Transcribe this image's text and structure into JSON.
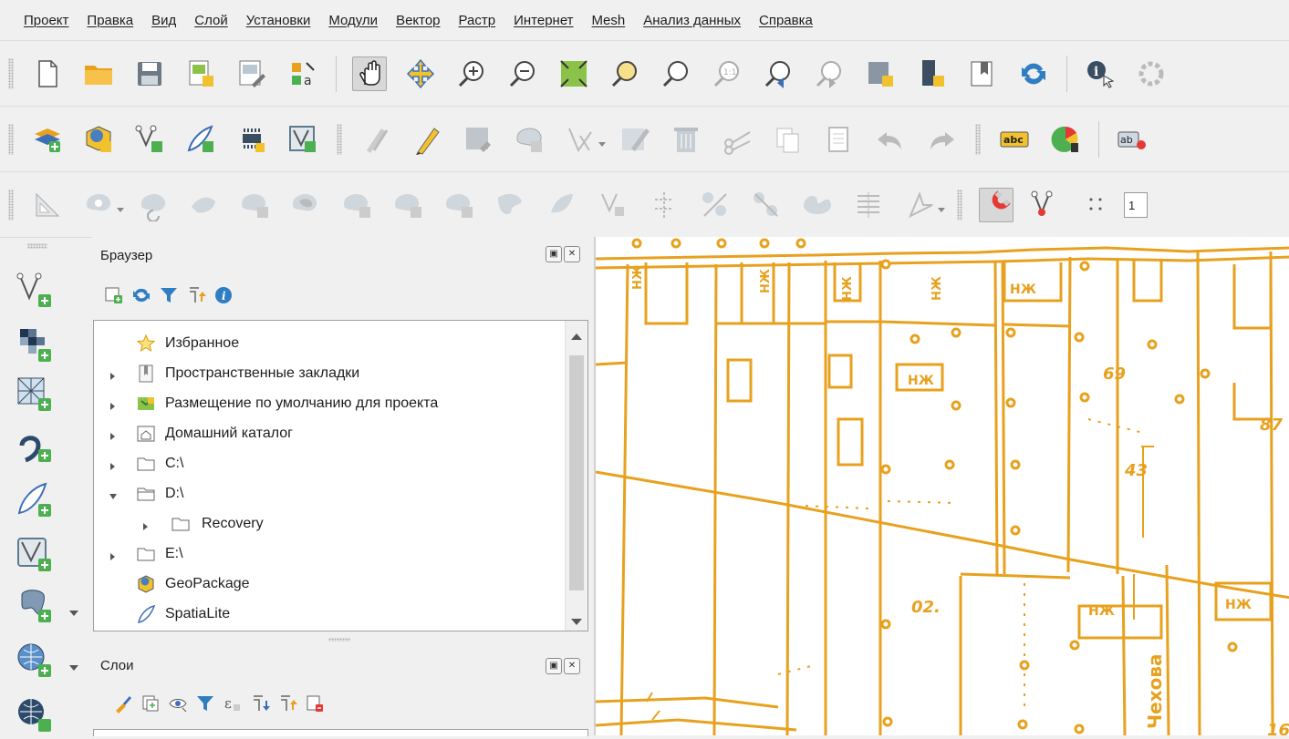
{
  "menubar": {
    "items": [
      "Проект",
      "Правка",
      "Вид",
      "Слой",
      "Установки",
      "Модули",
      "Вектор",
      "Растр",
      "Интернет",
      "Mesh",
      "Анализ данных",
      "Справка"
    ]
  },
  "toolbar3": {
    "snap_tolerance_value": "1"
  },
  "browser": {
    "title": "Браузер",
    "tree": [
      {
        "label": "Избранное",
        "icon": "star-icon",
        "expandable": false,
        "level": 0
      },
      {
        "label": "Пространственные закладки",
        "icon": "bookmark-icon",
        "expandable": true,
        "level": 0
      },
      {
        "label": "Размещение по умолчанию для проекта",
        "icon": "project-home-icon",
        "expandable": true,
        "level": 0
      },
      {
        "label": "Домашний каталог",
        "icon": "home-folder-icon",
        "expandable": true,
        "level": 0
      },
      {
        "label": "C:\\",
        "icon": "folder-icon",
        "expandable": true,
        "level": 0
      },
      {
        "label": "D:\\",
        "icon": "folder-open-icon",
        "expandable": true,
        "expanded": true,
        "level": 0
      },
      {
        "label": "Recovery",
        "icon": "folder-icon",
        "expandable": true,
        "level": 1
      },
      {
        "label": "E:\\",
        "icon": "folder-icon",
        "expandable": true,
        "level": 0
      },
      {
        "label": "GeoPackage",
        "icon": "geopackage-icon",
        "expandable": false,
        "level": 0
      },
      {
        "label": "SpatiaLite",
        "icon": "spatialite-icon",
        "expandable": false,
        "level": 0
      }
    ]
  },
  "layers": {
    "title": "Слои"
  },
  "map": {
    "labels": [
      "НЖ",
      "НЖ",
      "НЖ",
      "НЖ",
      "НЖ",
      "НЖ",
      "НЖ",
      "НЖ",
      "69",
      "87",
      "43",
      "02.",
      "Чехова",
      "16"
    ],
    "line_color": "#e8a11e"
  },
  "colors": {
    "accent": "#e8a11e",
    "panel_bg": "#f0f0f0"
  }
}
